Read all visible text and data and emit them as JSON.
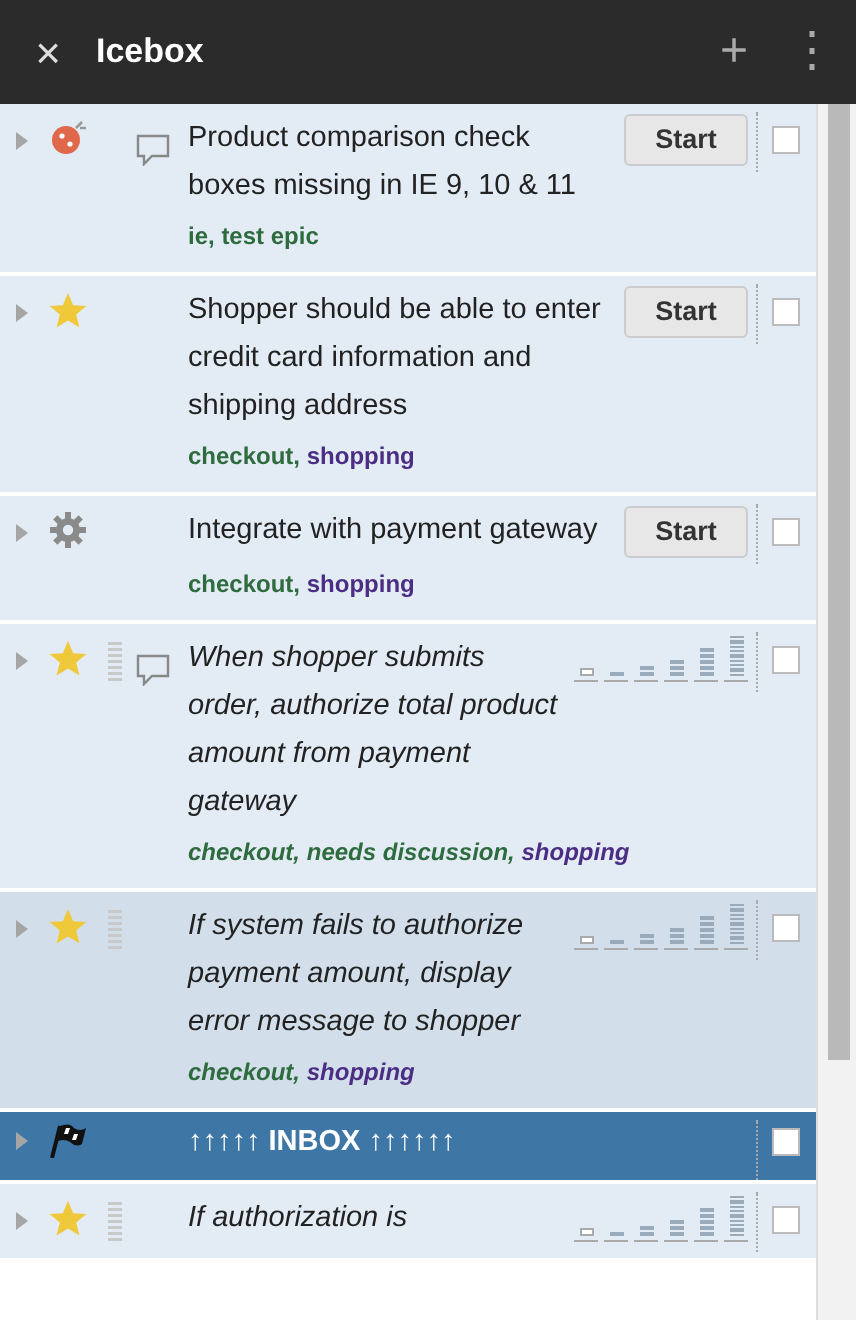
{
  "panel": {
    "close": "×",
    "title": "Icebox",
    "add": "+",
    "menu": "⋮"
  },
  "stories": [
    {
      "kind": "bug",
      "title": "Product comparison check boxes missing in IE 9, 10 & 11",
      "has_comment": true,
      "estimated": true,
      "action": "Start",
      "italic": false,
      "highlighted": false,
      "checked": false,
      "labels": [
        {
          "text": "ie,",
          "color": "#2e6b3e"
        },
        {
          "text": "test epic",
          "color": "#2e6b3e"
        }
      ]
    },
    {
      "kind": "feature",
      "title": "Shopper should be able to enter credit card information and shipping address",
      "has_comment": false,
      "estimated": true,
      "action": "Start",
      "italic": false,
      "highlighted": false,
      "checked": false,
      "labels": [
        {
          "text": "checkout,",
          "color": "#2e6b3e"
        },
        {
          "text": "shopping",
          "color": "#4b2e83"
        }
      ]
    },
    {
      "kind": "chore",
      "title": "Integrate with payment gateway",
      "has_comment": false,
      "estimated": true,
      "action": "Start",
      "italic": false,
      "highlighted": false,
      "checked": false,
      "labels": [
        {
          "text": "checkout,",
          "color": "#2e6b3e"
        },
        {
          "text": "shopping",
          "color": "#4b2e83"
        }
      ]
    },
    {
      "kind": "feature",
      "title": "When shopper submits order, authorize total product amount from payment gateway",
      "has_comment": true,
      "estimated": false,
      "italic": true,
      "highlighted": false,
      "checked": false,
      "labels": [
        {
          "text": "checkout,",
          "color": "#2e6b3e"
        },
        {
          "text": "needs discussion,",
          "color": "#2e6b3e"
        },
        {
          "text": "shopping",
          "color": "#4b2e83"
        }
      ]
    },
    {
      "kind": "feature",
      "title": "If system fails to authorize payment amount, display error message to shopper",
      "has_comment": false,
      "estimated": false,
      "italic": true,
      "highlighted": true,
      "checked": false,
      "labels": [
        {
          "text": "checkout,",
          "color": "#2e6b3e"
        },
        {
          "text": "shopping",
          "color": "#4b2e83"
        }
      ]
    },
    {
      "kind": "release",
      "title": "↑↑↑↑↑ INBOX ↑↑↑↑↑↑",
      "checked": false
    },
    {
      "kind": "feature",
      "title": "If authorization is",
      "has_comment": false,
      "estimated": false,
      "italic": true,
      "highlighted": false,
      "checked": false
    }
  ]
}
